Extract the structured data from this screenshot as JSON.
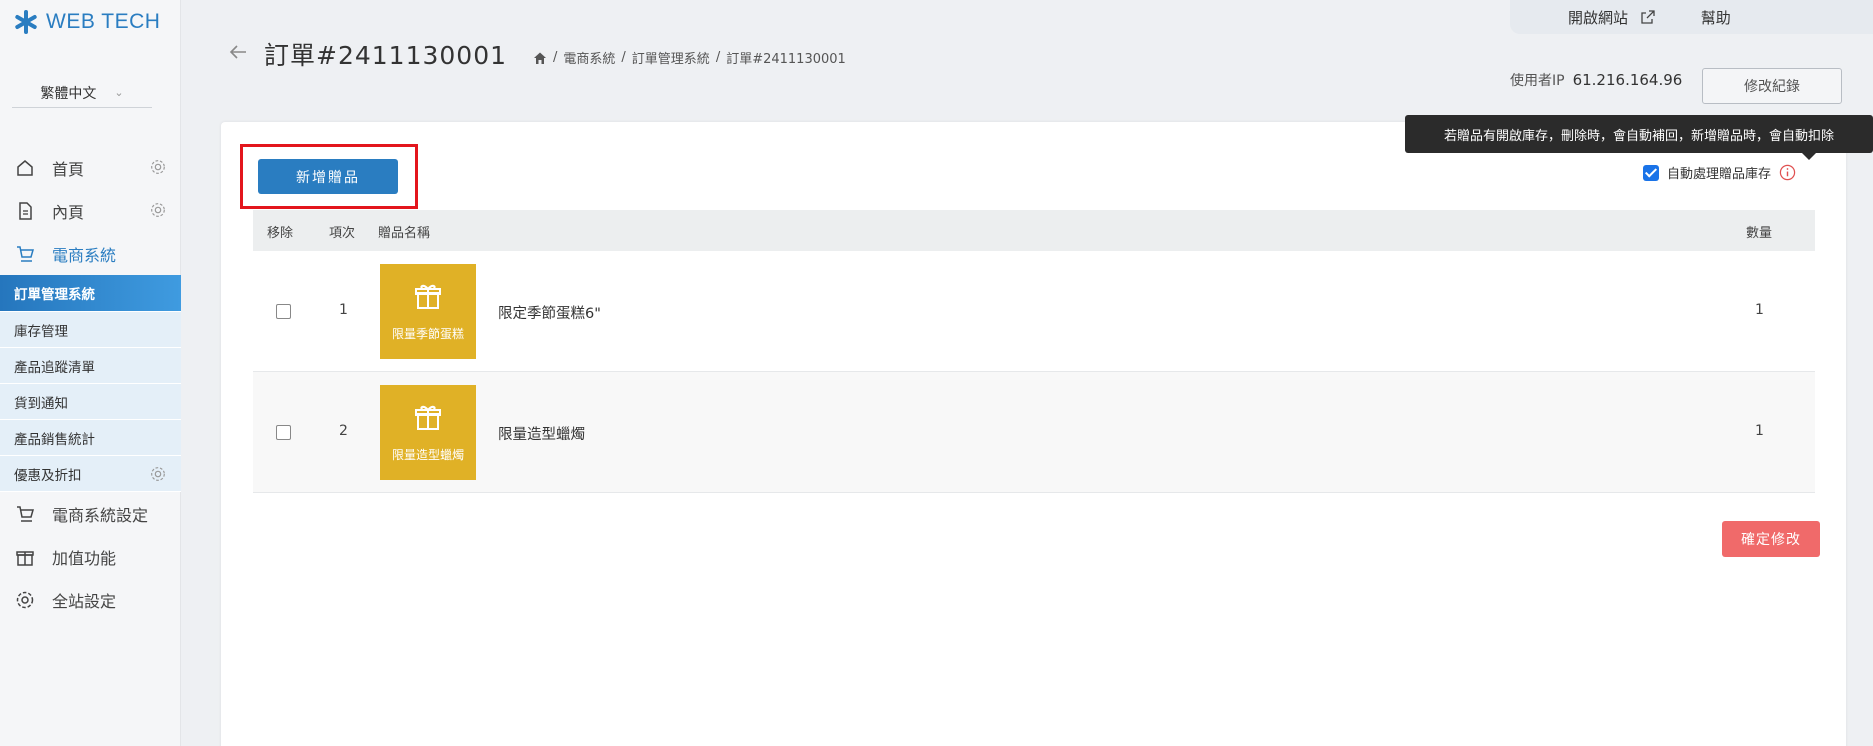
{
  "brand": {
    "name": "WEB TECH"
  },
  "language": {
    "selected": "繁體中文"
  },
  "sidebar": {
    "items": [
      {
        "label": "首頁",
        "icon": "home-icon"
      },
      {
        "label": "內頁",
        "icon": "page-icon"
      },
      {
        "label": "電商系統",
        "icon": "cart-icon"
      }
    ],
    "sub_items": [
      {
        "label": "訂單管理系統"
      },
      {
        "label": "庫存管理"
      },
      {
        "label": "產品追蹤清單"
      },
      {
        "label": "貨到通知"
      },
      {
        "label": "產品銷售統計"
      },
      {
        "label": "優惠及折扣"
      }
    ],
    "bottom_items": [
      {
        "label": "電商系統設定",
        "icon": "cart-icon"
      },
      {
        "label": "加值功能",
        "icon": "gift-icon"
      },
      {
        "label": "全站設定",
        "icon": "gear-icon"
      }
    ]
  },
  "topbar": {
    "open_site": "開啟網站",
    "help": "幫助"
  },
  "header": {
    "title": "訂單#2411130001",
    "breadcrumb": [
      "電商系統",
      "訂單管理系統",
      "訂單#2411130001"
    ],
    "ip_label": "使用者IP",
    "ip_value": "61.216.164.96",
    "log_button": "修改紀錄"
  },
  "gifts": {
    "add_button": "新增贈品",
    "tooltip": "若贈品有開啟庫存，刪除時，會自動補回，新增贈品時，會自動扣除",
    "auto_stock_label": "自動處理贈品庫存",
    "auto_stock_checked": true,
    "columns": {
      "remove": "移除",
      "index": "項次",
      "name": "贈品名稱",
      "qty": "數量"
    },
    "rows": [
      {
        "index": "1",
        "thumb_label": "限量季節蛋糕",
        "name": "限定季節蛋糕6\"",
        "qty": "1"
      },
      {
        "index": "2",
        "thumb_label": "限量造型蠟燭",
        "name": "限量造型蠟燭",
        "qty": "1"
      }
    ],
    "confirm_button": "確定修改"
  },
  "colors": {
    "accent": "#2a7dc1",
    "danger": "#f06a6a",
    "thumb": "#e0b126",
    "highlight": "#e3161d"
  }
}
